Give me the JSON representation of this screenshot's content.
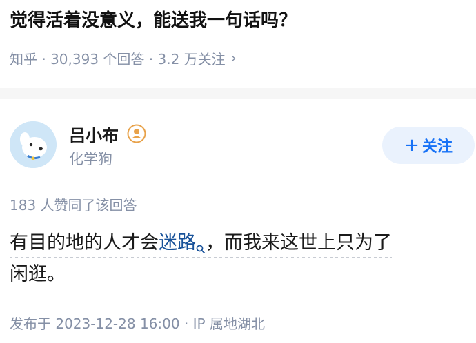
{
  "question": {
    "title": "觉得活着没意义，能送我一句话吗？",
    "meta": "知乎 · 30,393 个回答 · 3.2 万关注",
    "chevron": "›"
  },
  "author": {
    "name": "吕小布",
    "bio": "化学狗",
    "avatar_icon": "dog-avatar",
    "badge_icon": "user-badge-icon",
    "follow_plus": "+",
    "follow_label": "关注"
  },
  "answer": {
    "votes": "183 人赞同了该回答",
    "line1_before": "有目的地的人才会",
    "line1_link": "迷路",
    "line1_after": "，而我来这世上只为了",
    "line2": "闲逛。",
    "published": "发布于 2023-12-28 16:00 · IP 属地湖北"
  },
  "colors": {
    "link": "#175199",
    "follow_text": "#1772f6",
    "follow_bg": "#eaf2fd",
    "meta_gray": "#8590a6",
    "badge": "#e8a24a"
  }
}
